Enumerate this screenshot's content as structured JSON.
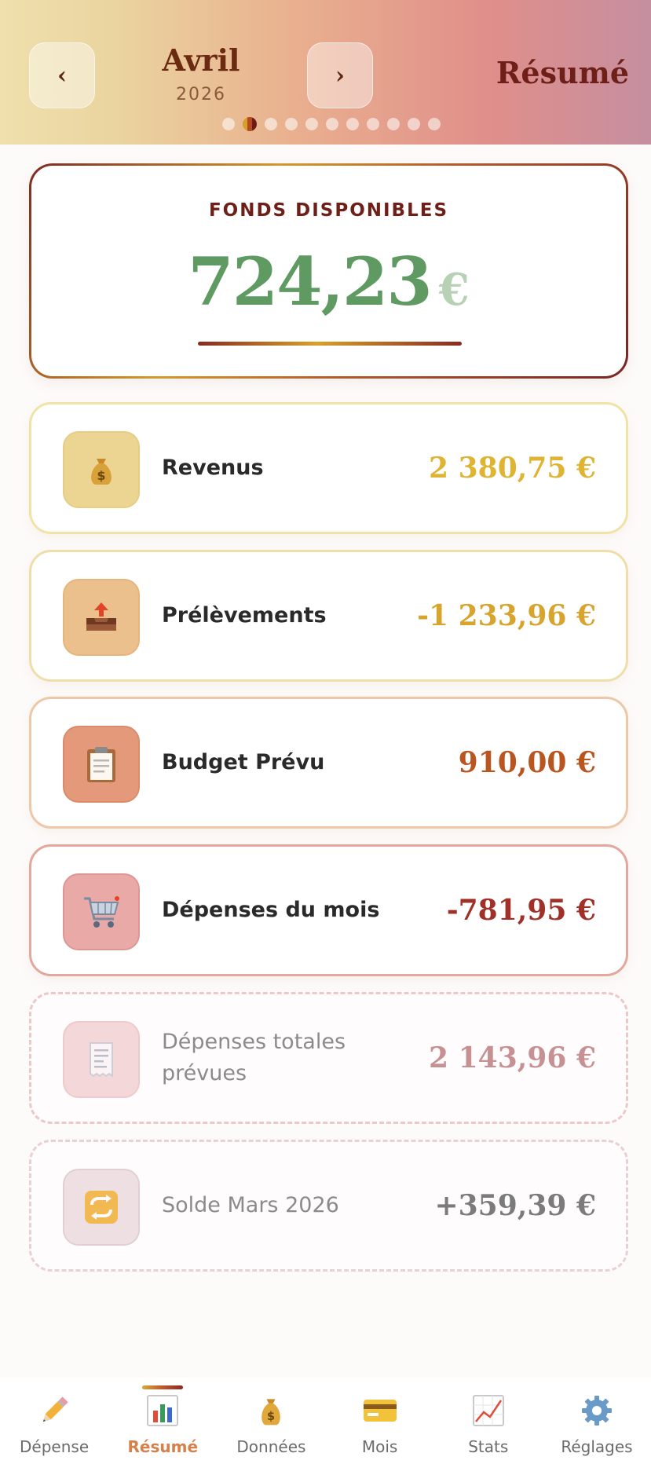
{
  "header": {
    "prev_label": "‹",
    "next_label": "›",
    "month": "Avril",
    "year": "2026",
    "title": "Résumé",
    "dots_count": 11,
    "active_dot_index": 1
  },
  "fonds": {
    "label": "FONDS DISPONIBLES",
    "amount": "724,23",
    "currency": "€",
    "color": "#5f9a62"
  },
  "rows": [
    {
      "icon": "money-bag-icon",
      "label": "Revenus",
      "value": "2 380,75 €",
      "color": "#dfb433"
    },
    {
      "icon": "outbox-tray-icon",
      "label": "Prélèvements",
      "value": "-1 233,96 €",
      "color": "#d7a42e"
    },
    {
      "icon": "clipboard-icon",
      "label": "Budget Prévu",
      "value": "910,00 €",
      "color": "#b9551f"
    },
    {
      "icon": "shopping-cart-icon",
      "label": "Dépenses du mois",
      "value": "-781,95 €",
      "color": "#a13028"
    },
    {
      "icon": "receipt-icon",
      "label": "Dépenses totales prévues",
      "value": "2 143,96 €",
      "color": "#c79093"
    },
    {
      "icon": "repeat-arrows-icon",
      "label": "Solde Mars 2026",
      "value": "+359,39 €",
      "color": "#7b7b7b"
    }
  ],
  "bottom_nav": [
    {
      "icon": "pencil-icon",
      "label": "Dépense"
    },
    {
      "icon": "bar-chart-icon",
      "label": "Résumé"
    },
    {
      "icon": "money-bag-icon",
      "label": "Données"
    },
    {
      "icon": "credit-card-icon",
      "label": "Mois"
    },
    {
      "icon": "trend-chart-icon",
      "label": "Stats"
    },
    {
      "icon": "gear-icon",
      "label": "Réglages"
    }
  ],
  "active_nav_index": 1
}
